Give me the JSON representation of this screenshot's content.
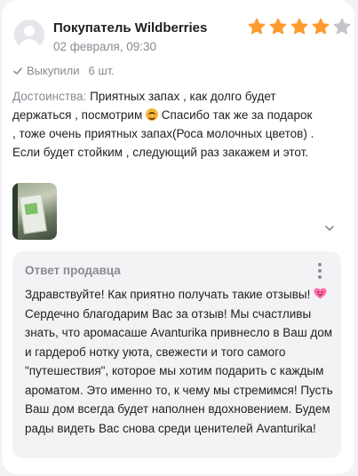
{
  "review": {
    "author": "Покупатель Wildberries",
    "date": "02 февраля, 09:30",
    "rating": 4,
    "rating_max": 5,
    "bought_label": "Выкупили",
    "quantity": "6 шт.",
    "pros_label": "Достоинства:",
    "text_part1": "Приятных запах , как долго будет держаться , посмотрим",
    "text_part2": "Спасибо так же за подарок , тоже очень приятных запах(Роса молочных цветов) . Если будет стойким , следующий раз закажем и этот.",
    "emoji_icon": "smiling-face-icon"
  },
  "seller_reply": {
    "title": "Ответ продавца",
    "line1": "Здравствуйте! Как приятно получать такие отзывы!",
    "emoji_icon": "heart-face-icon",
    "text_rest": "Сердечно благодарим Вас за отзыв! Мы счастливы знать, что аромасаше Avanturika привнесло в Ваш дом и гардероб нотку уюта, свежести и того самого \"путешествия\", которое мы хотим подарить с каждым ароматом. Это именно то, к чему мы стремимся! Пусть Ваш дом всегда будет наполнен вдохновением. Будем рады видеть Вас снова среди ценителей Avanturika!"
  },
  "colors": {
    "star_filled": "#ff9a2e",
    "star_empty": "#c4c4cc",
    "muted_text": "#8a8a95",
    "reply_bg": "#f3f3f6"
  }
}
